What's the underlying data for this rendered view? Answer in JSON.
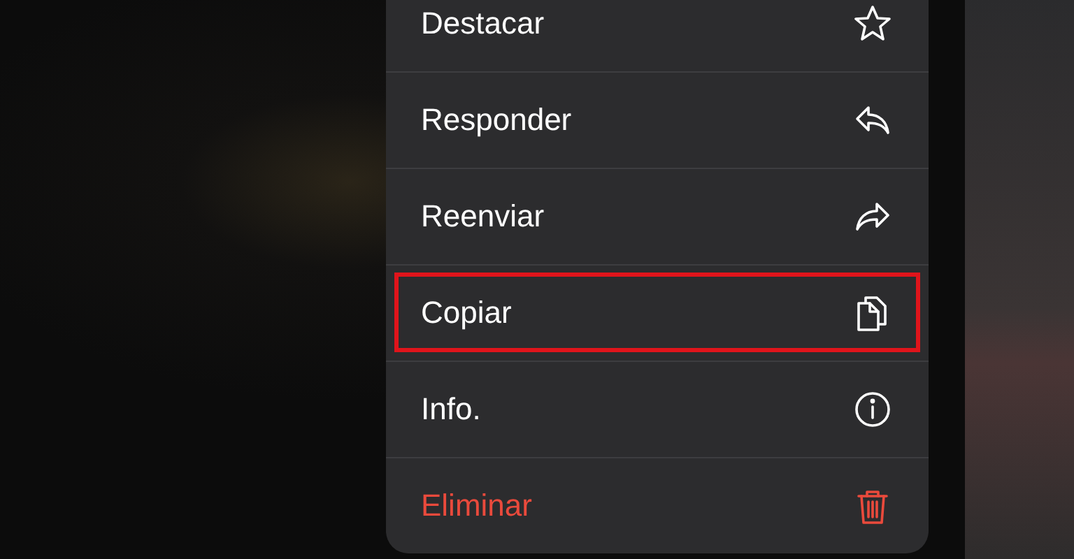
{
  "menu": {
    "items": [
      {
        "label": "Destacar",
        "kind": "normal",
        "highlighted": false
      },
      {
        "label": "Responder",
        "kind": "normal",
        "highlighted": false
      },
      {
        "label": "Reenviar",
        "kind": "normal",
        "highlighted": false
      },
      {
        "label": "Copiar",
        "kind": "normal",
        "highlighted": true
      },
      {
        "label": "Info.",
        "kind": "normal",
        "highlighted": false
      },
      {
        "label": "Eliminar",
        "kind": "destructive",
        "highlighted": false
      }
    ]
  }
}
